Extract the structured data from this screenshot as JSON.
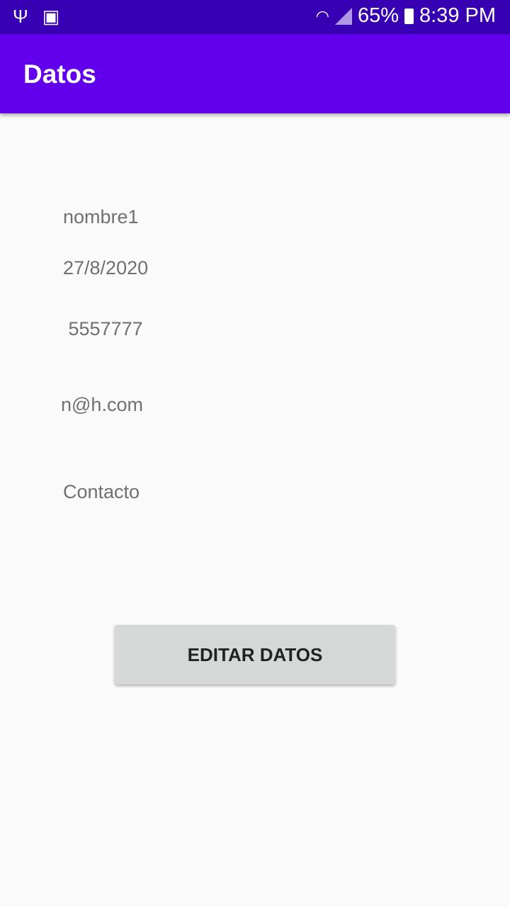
{
  "status_bar": {
    "battery": "65%",
    "time": "8:39 PM",
    "icons": [
      "usb-icon",
      "image-icon",
      "wifi-icon",
      "signal-icon",
      "battery-charging-icon"
    ]
  },
  "app_bar": {
    "title": "Datos"
  },
  "fields": {
    "name": "nombre1",
    "date": "27/8/2020",
    "phone": " 5557777",
    "email": "n@h.com",
    "description": "Contacto"
  },
  "button": {
    "label": "EDITAR DATOS"
  },
  "colors": {
    "status_bar": "#3700b3",
    "app_bar": "#6200ee",
    "button": "#d6d7d7"
  }
}
